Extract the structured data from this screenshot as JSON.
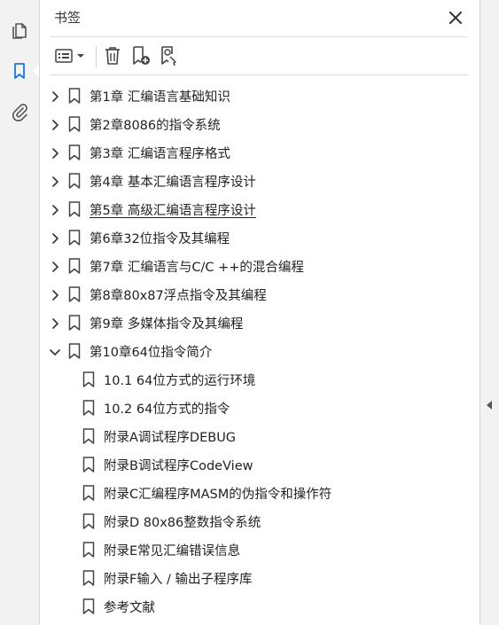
{
  "left_rail": {
    "items": [
      {
        "name": "pages-thumbnail-icon"
      },
      {
        "name": "bookmark-icon",
        "active": true
      },
      {
        "name": "attachment-icon"
      }
    ],
    "accent_color": "#1a73e8"
  },
  "panel": {
    "title": "书签"
  },
  "bookmarks": [
    {
      "label": "第1章  汇编语言基础知识",
      "level": 0,
      "expanded": false
    },
    {
      "label": "第2章8086的指令系统",
      "level": 0,
      "expanded": false
    },
    {
      "label": "第3章  汇编语言程序格式",
      "level": 0,
      "expanded": false
    },
    {
      "label": "第4章  基本汇编语言程序设计",
      "level": 0,
      "expanded": false
    },
    {
      "label": "第5章  高级汇编语言程序设计",
      "level": 0,
      "expanded": false,
      "hovered": true
    },
    {
      "label": "第6章32位指令及其编程",
      "level": 0,
      "expanded": false
    },
    {
      "label": "第7章  汇编语言与C/C ++的混合编程",
      "level": 0,
      "expanded": false
    },
    {
      "label": "第8章80x87浮点指令及其编程",
      "level": 0,
      "expanded": false
    },
    {
      "label": "第9章  多媒体指令及其编程",
      "level": 0,
      "expanded": false
    },
    {
      "label": "第10章64位指令简介",
      "level": 0,
      "expanded": true
    },
    {
      "label": "10.1  64位方式的运行环境",
      "level": 1
    },
    {
      "label": "10.2  64位方式的指令",
      "level": 1
    },
    {
      "label": "附录A调试程序DEBUG",
      "level": 1
    },
    {
      "label": "附录B调试程序CodeView",
      "level": 1
    },
    {
      "label": "附录C汇编程序MASM的伪指令和操作符",
      "level": 1
    },
    {
      "label": "附录D 80x86整数指令系统",
      "level": 1
    },
    {
      "label": "附录E常见汇编错误信息",
      "level": 1
    },
    {
      "label": "附录F输入 / 输出子程序库",
      "level": 1
    },
    {
      "label": "参考文献",
      "level": 1
    }
  ]
}
